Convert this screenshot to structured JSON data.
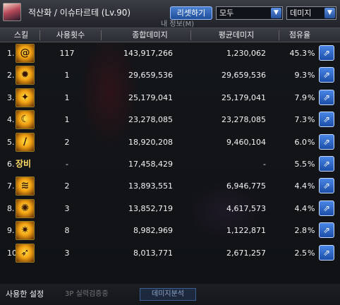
{
  "header": {
    "title": "적산화 / 이슈타르테 (Lv.90)",
    "subtitle": "내 정보(M)",
    "reset_label": "리셋하기",
    "filter_select": "모두",
    "metric_select": "데미지",
    "select_arrow": "▼"
  },
  "columns": {
    "skill": "스킬",
    "count": "사용횟수",
    "total": "종합데미지",
    "avg": "평균데미지",
    "share": "점유율"
  },
  "rows": [
    {
      "rank": "1.",
      "icon": "skill-spiral-icon",
      "count": "117",
      "total": "143,917,266",
      "avg": "1,230,062",
      "share": "45.3",
      "unit": "%"
    },
    {
      "rank": "2.",
      "icon": "skill-sunburst-icon",
      "count": "1",
      "total": "29,659,536",
      "avg": "29,659,536",
      "share": "9.3",
      "unit": "%"
    },
    {
      "rank": "3.",
      "icon": "skill-starburst-icon",
      "count": "1",
      "total": "25,179,041",
      "avg": "25,179,041",
      "share": "7.9",
      "unit": "%"
    },
    {
      "rank": "4.",
      "icon": "skill-crescent-icon",
      "count": "1",
      "total": "23,278,085",
      "avg": "23,278,085",
      "share": "7.3",
      "unit": "%"
    },
    {
      "rank": "5.",
      "icon": "skill-slash-icon",
      "count": "2",
      "total": "18,920,208",
      "avg": "9,460,104",
      "share": "6.0",
      "unit": "%"
    },
    {
      "rank": "6.",
      "icon_text": "장비",
      "count": "-",
      "total": "17,458,429",
      "avg": "-",
      "share": "5.5",
      "unit": "%"
    },
    {
      "rank": "7.",
      "icon": "skill-claw-icon",
      "count": "2",
      "total": "13,893,551",
      "avg": "6,946,775",
      "share": "4.4",
      "unit": "%"
    },
    {
      "rank": "8.",
      "icon": "skill-whirl-icon",
      "count": "3",
      "total": "13,852,719",
      "avg": "4,617,573",
      "share": "4.4",
      "unit": "%"
    },
    {
      "rank": "9.",
      "icon": "skill-flare-icon",
      "count": "8",
      "total": "8,982,969",
      "avg": "1,122,871",
      "share": "2.8",
      "unit": "%"
    },
    {
      "rank": "10.",
      "icon": "skill-streak-icon",
      "count": "3",
      "total": "8,013,771",
      "avg": "2,671,257",
      "share": "2.5",
      "unit": "%"
    }
  ],
  "footer": {
    "settings_label": "사용한 설정",
    "bg_text_a": "3P 실력검증중",
    "bg_text_b": "데미지분석"
  },
  "colors": {
    "accent": "#2e64c0",
    "icon_gold": "#f0a012"
  }
}
